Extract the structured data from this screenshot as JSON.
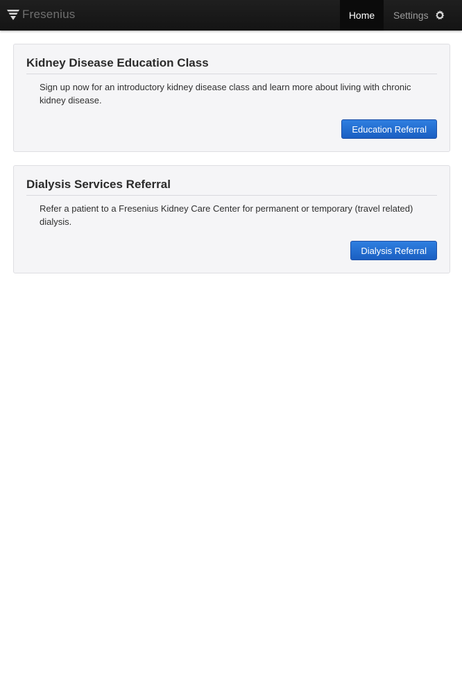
{
  "navbar": {
    "brand_name": "Fresenius",
    "brand_icon": "fresenius-logo-icon",
    "home_label": "Home",
    "settings_label": "Settings",
    "settings_icon": "gear-icon",
    "colors": {
      "background": "#171717",
      "active_tab": "#0b0b0b",
      "brand_text": "#6f6f6f"
    }
  },
  "panels": [
    {
      "title": "Kidney Disease Education Class",
      "description": "Sign up now for an introductory kidney disease class and learn more about living with chronic kidney disease.",
      "button_label": "Education Referral"
    },
    {
      "title": "Dialysis Services Referral",
      "description": "Refer a patient to a Fresenius Kidney Care Center for permanent or temporary (travel related) dialysis.",
      "button_label": "Dialysis Referral"
    }
  ],
  "colors": {
    "button_blue": "#1f66c8",
    "panel_bg": "#f5f5f7"
  }
}
